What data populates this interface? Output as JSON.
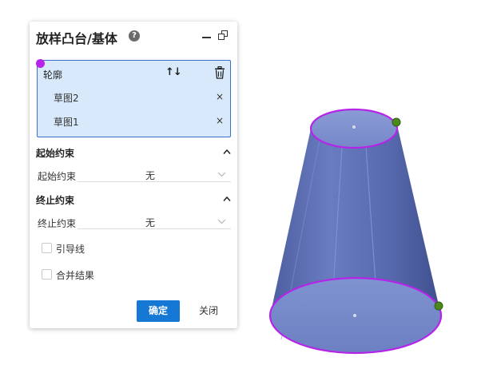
{
  "panel": {
    "title": "放样凸台/基体",
    "help_glyph": "?",
    "profile": {
      "label": "轮廓",
      "sort_glyph": "↑↓",
      "sketches": [
        {
          "name": "草图2",
          "close_glyph": "×"
        },
        {
          "name": "草图1",
          "close_glyph": "×"
        }
      ]
    },
    "start_constraint": {
      "section_title": "起始约束",
      "field_label": "起始约束",
      "value": "无"
    },
    "end_constraint": {
      "section_title": "终止约束",
      "field_label": "终止约束",
      "value": "无"
    },
    "options": {
      "guide_curve_label": "引导线",
      "merge_result_label": "合并结果"
    },
    "buttons": {
      "ok_label": "确定",
      "close_label": "关闭"
    }
  },
  "colors": {
    "accent": "#1478d4",
    "profile_bg": "#d8e9fb",
    "highlight_edge": "#b524e8",
    "solid_fill": "#6476b8",
    "point_marker": "#4a8a1a"
  },
  "viewport": {
    "model": "lofted-frustum"
  }
}
